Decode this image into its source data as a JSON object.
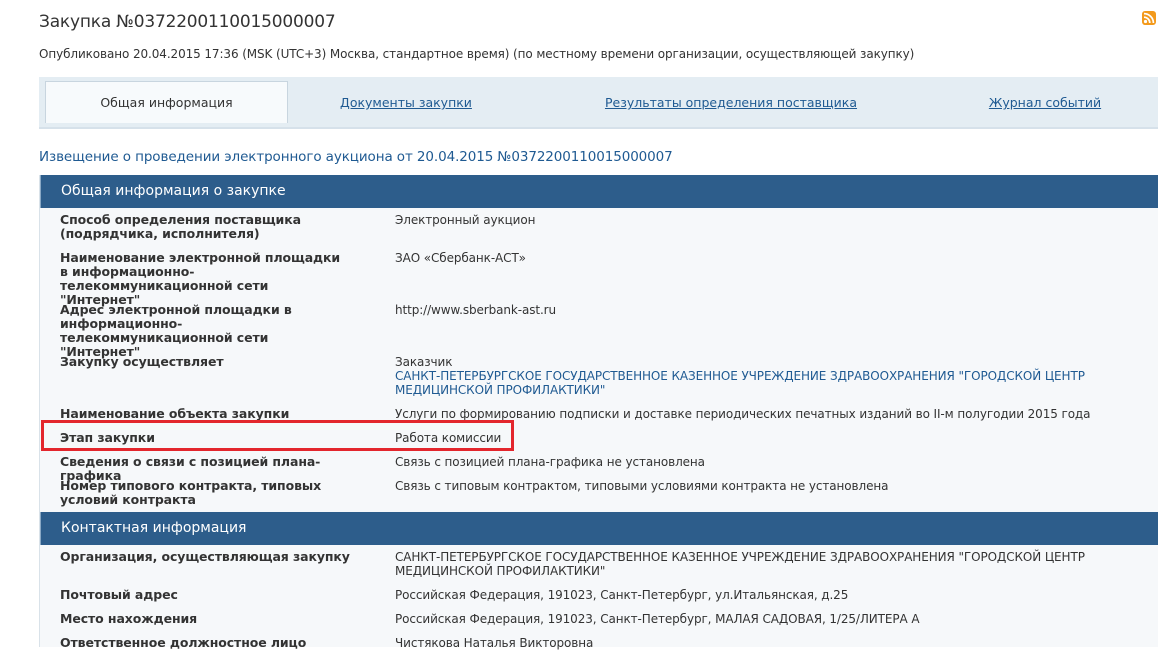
{
  "header": {
    "title": "Закупка №0372200110015000007",
    "published": "Опубликовано 20.04.2015 17:36 (MSK (UTC+3) Москва, стандартное время) (по местному времени организации, осуществляющей закупку)"
  },
  "tabs": [
    {
      "label": "Общая информация"
    },
    {
      "label": "Документы закупки"
    },
    {
      "label": "Результаты определения поставщика"
    },
    {
      "label": "Журнал событий"
    }
  ],
  "notice_link": "Извещение о проведении электронного аукциона от 20.04.2015 №0372200110015000007",
  "general": {
    "header": "Общая информация о закупке",
    "rows": [
      {
        "label": "Способ определения поставщика (подрядчика, исполнителя)",
        "value": "Электронный аукцион"
      },
      {
        "label": "Наименование электронной площадки в информационно-телекоммуникационной сети \"Интернет\"",
        "value": "ЗАО «Сбербанк-АСТ»"
      },
      {
        "label": "Адрес электронной площадки в информационно-телекоммуникационной сети \"Интернет\"",
        "value": "http://www.sberbank-ast.ru"
      },
      {
        "label": "Закупку осуществляет",
        "value": "Заказчик",
        "link": "САНКТ-ПЕТЕРБУРГСКОЕ ГОСУДАРСТВЕННОЕ КАЗЕННОЕ УЧРЕЖДЕНИЕ ЗДРАВООХРАНЕНИЯ \"ГОРОДСКОЙ ЦЕНТР МЕДИЦИНСКОЙ ПРОФИЛАКТИКИ\""
      },
      {
        "label": "Наименование объекта закупки",
        "value": "Услуги по формированию подписки и доставке периодических печатных изданий во II-м полугодии 2015 года"
      },
      {
        "label": "Этап закупки",
        "value": "Работа комиссии"
      },
      {
        "label": "Сведения о связи с позицией плана-графика",
        "value": "Связь с позицией плана-графика не установлена"
      },
      {
        "label": "Номер типового контракта, типовых условий контракта",
        "value": "Связь с типовым контрактом, типовыми условиями контракта не установлена"
      }
    ]
  },
  "contact": {
    "header": "Контактная информация",
    "rows": [
      {
        "label": "Организация, осуществляющая закупку",
        "value": "САНКТ-ПЕТЕРБУРГСКОЕ ГОСУДАРСТВЕННОЕ КАЗЕННОЕ УЧРЕЖДЕНИЕ ЗДРАВООХРАНЕНИЯ \"ГОРОДСКОЙ ЦЕНТР МЕДИЦИНСКОЙ ПРОФИЛАКТИКИ\""
      },
      {
        "label": "Почтовый адрес",
        "value": "Российская Федерация, 191023, Санкт-Петербург, ул.Итальянская, д.25"
      },
      {
        "label": "Место нахождения",
        "value": "Российская Федерация, 191023, Санкт-Петербург, МАЛАЯ САДОВАЯ, 1/25/ЛИТЕРА А"
      },
      {
        "label": "Ответственное должностное лицо",
        "value": "Чистякова Наталья Викторовна"
      }
    ]
  },
  "colors": {
    "section_header_bg": "#2d5d8b",
    "link": "#1f5a92",
    "highlight_border": "#e3262d",
    "rss": "#f39a1c"
  },
  "icons": {
    "rss": "rss-feed-icon"
  }
}
